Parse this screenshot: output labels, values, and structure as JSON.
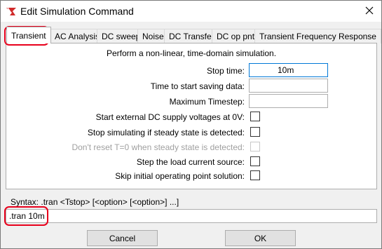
{
  "window": {
    "title": "Edit Simulation Command",
    "app_icon": "ltspice-icon",
    "close_icon": "close-icon"
  },
  "tabs": [
    {
      "label": "Transient",
      "active": true
    },
    {
      "label": "AC Analysis"
    },
    {
      "label": "DC sweep"
    },
    {
      "label": "Noise"
    },
    {
      "label": "DC Transfer"
    },
    {
      "label": "DC op pnt"
    },
    {
      "label": "Transient Frequency Response"
    }
  ],
  "transient": {
    "description": "Perform a non-linear, time-domain simulation.",
    "fields": {
      "stop_time": {
        "label": "Stop time:",
        "value": "10m"
      },
      "start_saving": {
        "label": "Time to start saving data:",
        "value": ""
      },
      "max_timestep": {
        "label": "Maximum Timestep:",
        "value": ""
      }
    },
    "checkboxes": {
      "start_dc_zero": {
        "label": "Start external DC supply voltages at 0V:",
        "checked": false
      },
      "stop_steady": {
        "label": "Stop simulating if steady state is detected:",
        "checked": false
      },
      "dont_reset": {
        "label": "Don't reset T=0 when steady state is detected:",
        "checked": false,
        "disabled": true
      },
      "step_load": {
        "label": "Step the load current source:",
        "checked": false
      },
      "skip_op": {
        "label": "Skip initial operating point solution:",
        "checked": false
      }
    }
  },
  "syntax": "Syntax:  .tran <Tstop> [<option> [<option>] ...]",
  "command": ".tran 10m",
  "buttons": {
    "cancel": "Cancel",
    "ok": "OK"
  },
  "colors": {
    "highlight": "#e8001c",
    "focus": "#0078d7"
  }
}
